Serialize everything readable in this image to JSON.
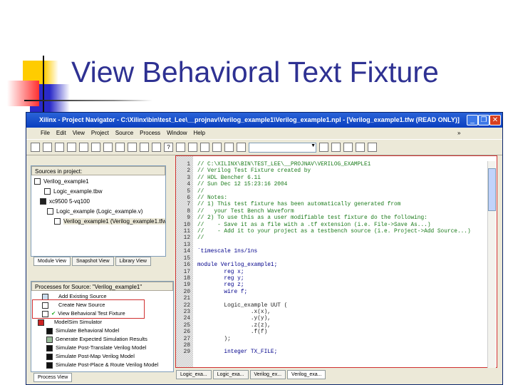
{
  "slide": {
    "title": "View Behavioral Text Fixture"
  },
  "window": {
    "title": "Xilinx - Project Navigator - C:\\Xilinx\\bin\\test_Lee\\__projnav\\Verilog_example1\\Verilog_example1.npl - [Verilog_example1.tfw (READ ONLY)]",
    "menu": [
      "File",
      "Edit",
      "View",
      "Project",
      "Source",
      "Process",
      "Window",
      "Help"
    ],
    "overflow": "»"
  },
  "sources": {
    "header": "Sources in project:",
    "items": [
      "Verilog_example1",
      "Logic_example.tbw",
      "xc9500 5-vq100",
      "Logic_example (Logic_example.v)",
      "Verilog_example1 (Verilog_example1.tfw)"
    ],
    "tabs": [
      "Module View",
      "Snapshot View",
      "Library View"
    ]
  },
  "processes": {
    "header": "Processes for Source: \"Verilog_example1\"",
    "items": [
      "Add Existing Source",
      "Create New Source",
      "View Behavioral Test Fixture",
      "ModelSim Simulator",
      "Simulate Behavioral Model",
      "Generate Expected Simulation Results",
      "Simulate Post-Translate Verilog Model",
      "Simulate Post-Map Verilog Model",
      "Simulate Post-Place & Route Verilog Model"
    ],
    "tab": "Process View"
  },
  "editor": {
    "lines": [
      {
        "n": "1",
        "text": "// C:\\XILINX\\BIN\\TEST_LEE\\__PROJNAV\\VERILOG_EXAMPLE1",
        "cls": "c"
      },
      {
        "n": "2",
        "text": "// Verilog Test Fixture created by",
        "cls": "c"
      },
      {
        "n": "3",
        "text": "// HDL Bencher 6.1i",
        "cls": "c"
      },
      {
        "n": "4",
        "text": "// Sun Dec 12 15:23:16 2004",
        "cls": "c"
      },
      {
        "n": "5",
        "text": "//",
        "cls": "c"
      },
      {
        "n": "6",
        "text": "// Notes:",
        "cls": "c"
      },
      {
        "n": "7",
        "text": "// 1) This test fixture has been automatically generated from",
        "cls": "c"
      },
      {
        "n": "8",
        "text": "//   your Test Bench Waveform",
        "cls": "c"
      },
      {
        "n": "9",
        "text": "// 2) To use this as a user modifiable test fixture do the following:",
        "cls": "c"
      },
      {
        "n": "10",
        "text": "//    - Save it as a file with a .tf extension (i.e. File->Save As...)",
        "cls": "c"
      },
      {
        "n": "11",
        "text": "//    - Add it to your project as a testbench source (i.e. Project->Add Source...)",
        "cls": "c"
      },
      {
        "n": "12",
        "text": "//",
        "cls": "c"
      },
      {
        "n": "13",
        "text": "",
        "cls": "t"
      },
      {
        "n": "14",
        "text": "`timescale 1ns/1ns",
        "cls": "k"
      },
      {
        "n": "15",
        "text": "",
        "cls": "t"
      },
      {
        "n": "16",
        "text": "module Verilog_example1;",
        "cls": "k"
      },
      {
        "n": "17",
        "text": "        reg x;",
        "cls": "k"
      },
      {
        "n": "18",
        "text": "        reg y;",
        "cls": "k"
      },
      {
        "n": "19",
        "text": "        reg z;",
        "cls": "k"
      },
      {
        "n": "20",
        "text": "        wire f;",
        "cls": "k"
      },
      {
        "n": "21",
        "text": "",
        "cls": "t"
      },
      {
        "n": "22",
        "text": "        Logic_example UUT (",
        "cls": "t"
      },
      {
        "n": "23",
        "text": "                .x(x),",
        "cls": "t"
      },
      {
        "n": "24",
        "text": "                .y(y),",
        "cls": "t"
      },
      {
        "n": "25",
        "text": "                .z(z),",
        "cls": "t"
      },
      {
        "n": "26",
        "text": "                .f(f)",
        "cls": "t"
      },
      {
        "n": "27",
        "text": "        );",
        "cls": "t"
      },
      {
        "n": "28",
        "text": "",
        "cls": "t"
      },
      {
        "n": "29",
        "text": "        integer TX_FILE;",
        "cls": "k"
      }
    ],
    "tabs": [
      "Logic_exa...",
      "Logic_exa...",
      "Verilog_ex...",
      "Verilog_exa..."
    ]
  },
  "colors": {
    "title": "#2e3192",
    "highlight": "#d03030",
    "titlebar": "#0a3fbf"
  }
}
